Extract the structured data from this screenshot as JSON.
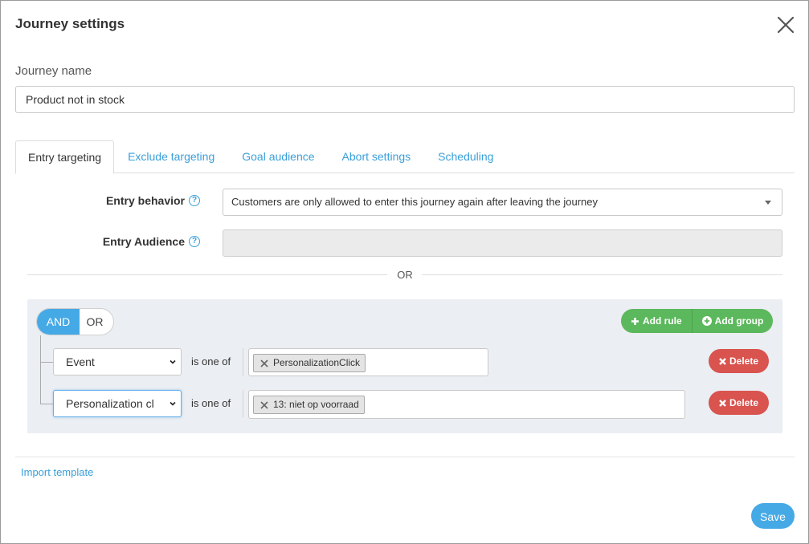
{
  "dialog": {
    "title": "Journey settings",
    "close_icon": "close-icon"
  },
  "journey_name": {
    "label": "Journey name",
    "value": "Product not in stock"
  },
  "tabs": [
    {
      "label": "Entry targeting",
      "active": true
    },
    {
      "label": "Exclude targeting",
      "active": false
    },
    {
      "label": "Goal audience",
      "active": false
    },
    {
      "label": "Abort settings",
      "active": false
    },
    {
      "label": "Scheduling",
      "active": false
    }
  ],
  "entry_behavior": {
    "label": "Entry behavior",
    "value": "Customers are only allowed to enter this journey again after leaving the journey"
  },
  "entry_audience": {
    "label": "Entry Audience",
    "value": ""
  },
  "separator_text": "OR",
  "builder": {
    "toggle_and": "AND",
    "toggle_or": "OR",
    "add_rule": "Add rule",
    "add_group": "Add group",
    "rules": [
      {
        "field": "Event",
        "operator": "is one of",
        "values": [
          "PersonalizationClick"
        ],
        "delete_label": "Delete"
      },
      {
        "field": "Personalization cl",
        "operator": "is one of",
        "values": [
          "13: niet op voorraad"
        ],
        "delete_label": "Delete"
      }
    ]
  },
  "footer": {
    "import_template": "Import template",
    "save": "Save"
  },
  "colors": {
    "accent": "#45a9e6",
    "link": "#3a9fd9",
    "add": "#5cb85c",
    "delete": "#d9534f"
  }
}
